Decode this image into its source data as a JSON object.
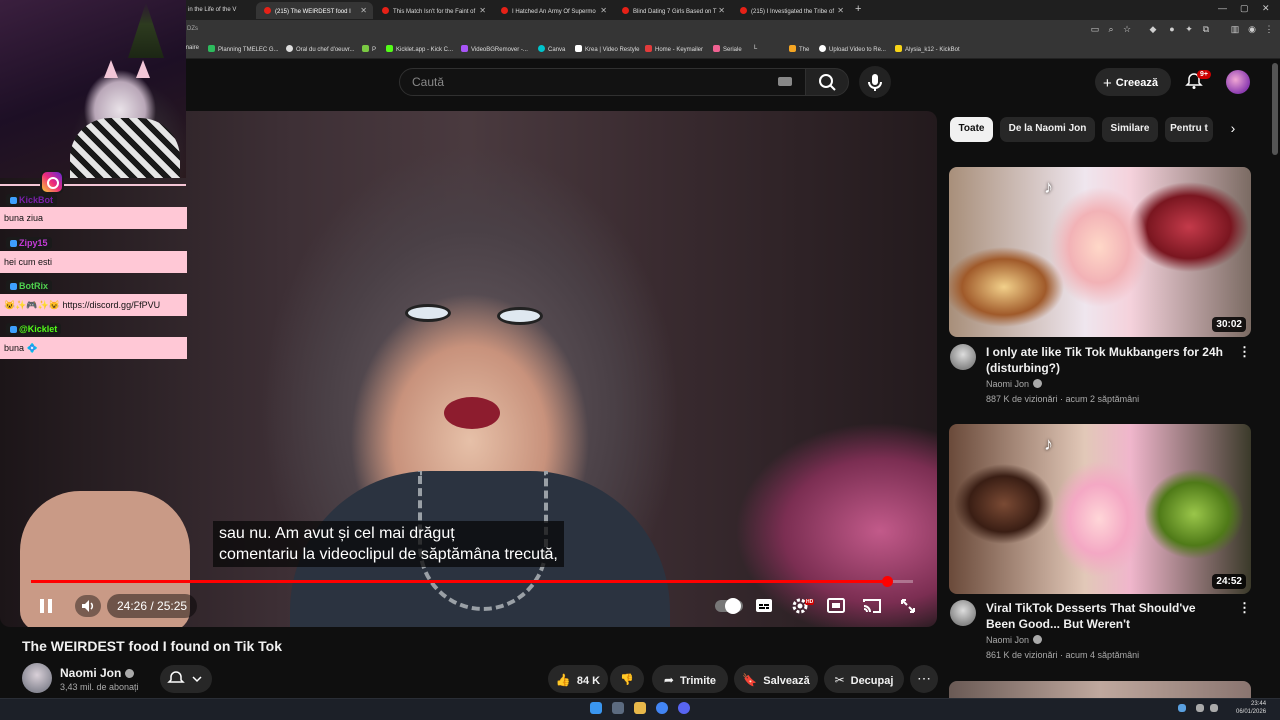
{
  "browser": {
    "tabs": [
      {
        "label": "in the Life of the V",
        "active": false
      },
      {
        "label": "(215) The WEIRDEST food I",
        "active": true
      },
      {
        "label": "This Match Isn't for the Faint of",
        "active": false
      },
      {
        "label": "I Hatched An Army Of Supermo",
        "active": false
      },
      {
        "label": "Blind Dating 7 Girls Based on T",
        "active": false
      },
      {
        "label": "(215) I Investigated the Tribe of",
        "active": false
      }
    ],
    "new_tab": "+",
    "address_fragment": "DZs",
    "bookmarks": [
      "maire",
      "Planning TMELEC G...",
      "Oral du chef d'oeuvr...",
      "P",
      "Kicklet.app - Kick C...",
      "VideoBGRemover -...",
      "Canva",
      "Krea | Video Restyle",
      "Home - Keymailer",
      "Seriale",
      "L",
      "The",
      "Upload Video to Re...",
      "Alysia_k12 - KickBot"
    ]
  },
  "header": {
    "search_placeholder": "Caută",
    "create_label": "Creează",
    "notifications_badge": "9+"
  },
  "overlay": {
    "chat": [
      {
        "user": "KickBot",
        "user_color": "#7a1ea8",
        "message": "buna ziua"
      },
      {
        "user": "Zipy15",
        "user_color": "#c53bd6",
        "message": "hei cum esti"
      },
      {
        "user": "BotRix",
        "user_color": "#4fd14f",
        "message": "https://discord.gg/FfPVU"
      },
      {
        "user": "@Kicklet",
        "user_color": "#53fc18",
        "message": "buna"
      }
    ]
  },
  "player": {
    "captions": [
      "sau nu.  Am avut și cel mai drăguț",
      "comentariu la videoclipul de săptămâna trecută,"
    ],
    "time": "24:26 / 25:25",
    "progress": 0.97,
    "hd": "HD"
  },
  "video": {
    "title": "The WEIRDEST food I found on Tik Tok",
    "channel": "Naomi Jon",
    "subscribers": "3,43 mil. de abonați",
    "likes": "84 K",
    "share": "Trimite",
    "save": "Salvează",
    "clip": "Decupaj"
  },
  "chips": [
    "Toate",
    "De la Naomi Jon",
    "Similare",
    "Pentru t"
  ],
  "recommendations": [
    {
      "title": "I only ate like Tik Tok Mukbangers for 24h (disturbing?)",
      "channel": "Naomi Jon",
      "meta": "887 K de vizionări · acum 2 săptămâni",
      "duration": "30:02"
    },
    {
      "title": "Viral TikTok Desserts That Should've Been Good... But Weren't",
      "channel": "Naomi Jon",
      "meta": "861 K de vizionări · acum 4 săptămâni",
      "duration": "24:52"
    }
  ],
  "taskbar": {
    "time": "23:44",
    "date": "06/01/2026"
  },
  "colors": {
    "accent": "#ff0000",
    "background": "#0f0f0f",
    "chat_bg": "#ffc8d6"
  }
}
